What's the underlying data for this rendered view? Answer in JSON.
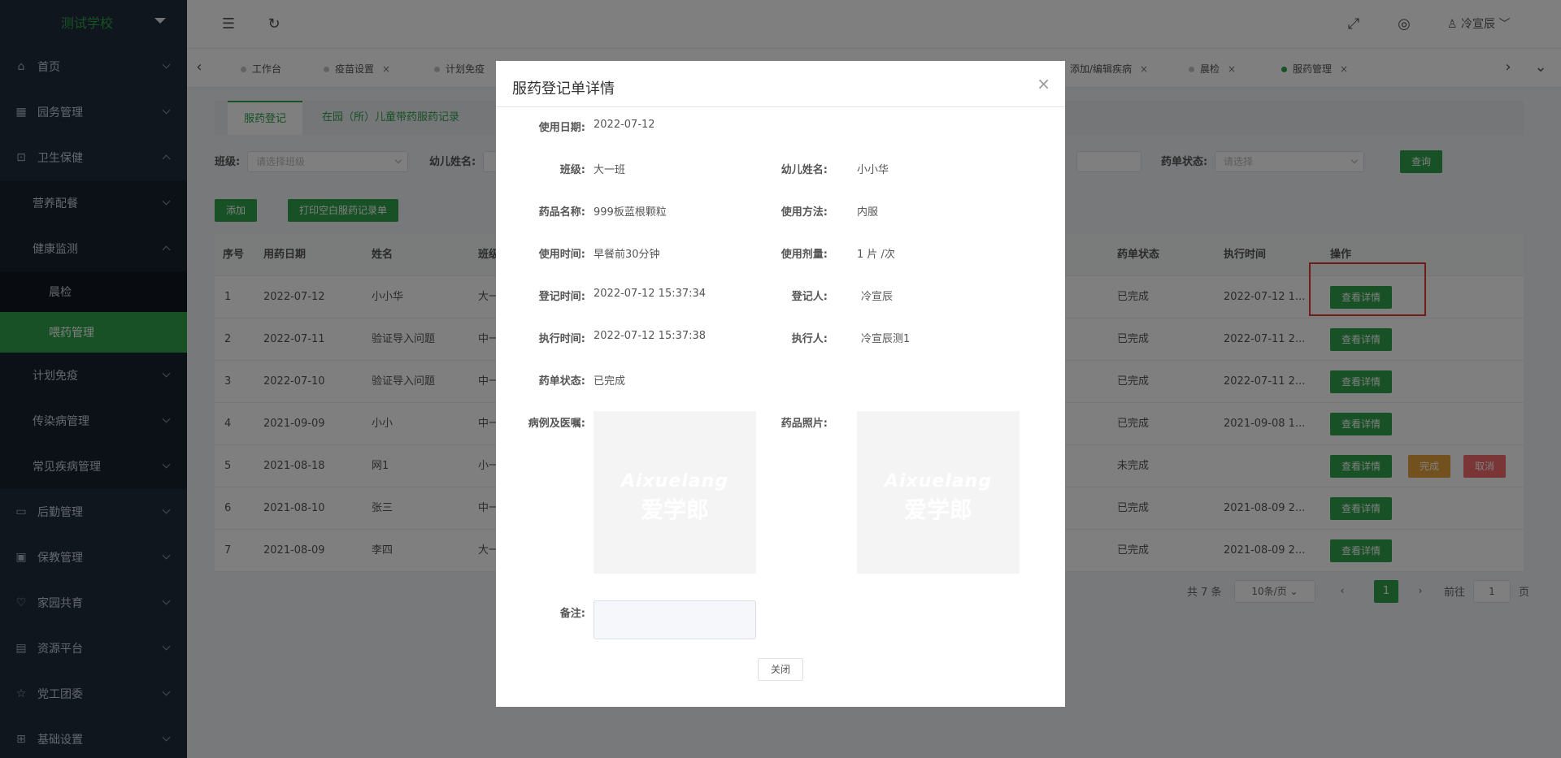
{
  "sidebar": {
    "school": "测试学校",
    "items": [
      {
        "label": "首页",
        "icon": "home-icon"
      },
      {
        "label": "园务管理",
        "icon": "building-icon"
      },
      {
        "label": "卫生保健",
        "icon": "health-icon"
      },
      {
        "label": "营养配餐"
      },
      {
        "label": "健康监测"
      },
      {
        "label": "晨检"
      },
      {
        "label": "喂药管理"
      },
      {
        "label": "计划免疫"
      },
      {
        "label": "传染病管理"
      },
      {
        "label": "常见疾病管理"
      },
      {
        "label": "后勤管理",
        "icon": "logistics-icon"
      },
      {
        "label": "保教管理",
        "icon": "briefcase-icon"
      },
      {
        "label": "家园共育",
        "icon": "heart-icon"
      },
      {
        "label": "资源平台",
        "icon": "archive-icon"
      },
      {
        "label": "党工团委",
        "icon": "star-icon"
      },
      {
        "label": "基础设置",
        "icon": "grid-icon"
      }
    ]
  },
  "header": {
    "user": "冷宣辰"
  },
  "tabs": [
    {
      "label": "工作台"
    },
    {
      "label": "疫苗设置"
    },
    {
      "label": "计划免疫"
    },
    {
      "label": "添加/编辑疾病"
    },
    {
      "label": "晨检"
    },
    {
      "label": "服药管理"
    }
  ],
  "subtabs": [
    "服药登记",
    "在园（所）儿童带药服药记录"
  ],
  "filters": {
    "class_label": "班级:",
    "class_placeholder": "请选择班级",
    "child_label": "幼儿姓名:",
    "status_label": "药单状态:",
    "status_placeholder": "请选择",
    "query": "查询"
  },
  "actions": {
    "add": "添加",
    "print": "打印空白服药记录单"
  },
  "table": {
    "headers": [
      "序号",
      "用药日期",
      "姓名",
      "班级",
      "药单状态",
      "执行时间",
      "操作"
    ],
    "rows": [
      {
        "no": "1",
        "date": "2022-07-12",
        "name": "小小华",
        "cls": "大一",
        "status": "已完成",
        "exec": "2022-07-12 1..."
      },
      {
        "no": "2",
        "date": "2022-07-11",
        "name": "验证导入问题",
        "cls": "中一",
        "status": "已完成",
        "exec": "2022-07-11 2..."
      },
      {
        "no": "3",
        "date": "2022-07-10",
        "name": "验证导入问题",
        "cls": "中一",
        "status": "已完成",
        "exec": "2022-07-11 2..."
      },
      {
        "no": "4",
        "date": "2021-09-09",
        "name": "小小",
        "cls": "中一",
        "status": "已完成",
        "exec": "2021-09-08 1..."
      },
      {
        "no": "5",
        "date": "2021-08-18",
        "name": "网1",
        "cls": "小一",
        "status": "未完成",
        "exec": ""
      },
      {
        "no": "6",
        "date": "2021-08-10",
        "name": "张三",
        "cls": "中一",
        "status": "已完成",
        "exec": "2021-08-09 2..."
      },
      {
        "no": "7",
        "date": "2021-08-09",
        "name": "李四",
        "cls": "大一",
        "status": "已完成",
        "exec": "2021-08-09 2..."
      }
    ],
    "view_btn": "查看详情",
    "complete_btn": "完成",
    "cancel_btn": "取消"
  },
  "pagination": {
    "total": "共 7 条",
    "page_size": "10条/页",
    "current": "1",
    "goto_label": "前往",
    "goto_value": "1",
    "page_suffix": "页"
  },
  "modal": {
    "title": "服药登记单详情",
    "fields": {
      "use_date_label": "使用日期:",
      "use_date": "2022-07-12",
      "class_label": "班级:",
      "class": "大一班",
      "child_label": "幼儿姓名:",
      "child": "小小华",
      "drug_label": "药品名称:",
      "drug": "999板蓝根颗粒",
      "method_label": "使用方法:",
      "method": "内服",
      "time_label": "使用时间:",
      "time": "早餐前30分钟",
      "dose_label": "使用剂量:",
      "dose": "1 片 /次",
      "reg_time_label": "登记时间:",
      "reg_time": "2022-07-12 15:37:34",
      "registrar_label": "登记人:",
      "registrar": "冷宣辰",
      "exec_time_label": "执行时间:",
      "exec_time": "2022-07-12 15:37:38",
      "executor_label": "执行人:",
      "executor": "冷宣辰测1",
      "status_label": "药单状态:",
      "status": "已完成",
      "case_label": "病例及医嘱:",
      "photo_label": "药品照片:",
      "note_label": "备注:"
    },
    "watermark_en": "Aixuelang",
    "watermark_cn": "爱学郎",
    "close": "关闭"
  }
}
